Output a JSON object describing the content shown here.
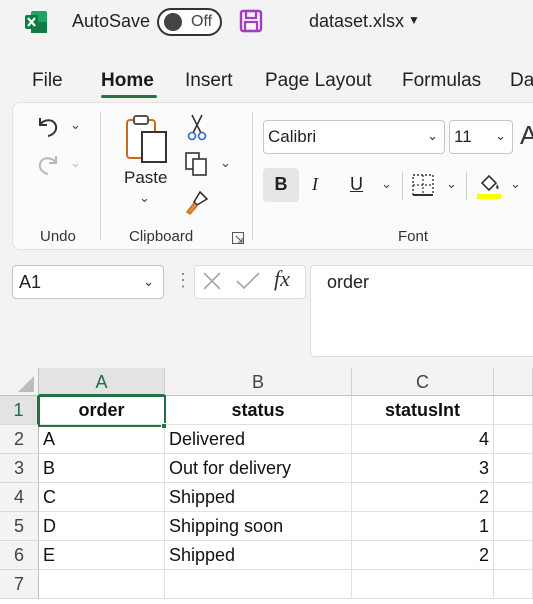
{
  "titlebar": {
    "autosave_label": "AutoSave",
    "autosave_state": "Off",
    "filename": "dataset.xlsx"
  },
  "tabs": [
    "File",
    "Home",
    "Insert",
    "Page Layout",
    "Formulas",
    "Da"
  ],
  "ribbon": {
    "groups": {
      "undo": "Undo",
      "clipboard": "Clipboard",
      "font": "Font"
    },
    "paste_label": "Paste",
    "font_name": "Calibri",
    "font_size": "11",
    "bold": "B",
    "italic": "I",
    "underline": "U",
    "grow_font": "A",
    "fill_color": "#ffff00"
  },
  "formula_bar": {
    "name_box": "A1",
    "fx_label": "fx",
    "formula": "order"
  },
  "sheet": {
    "columns": [
      "A",
      "B",
      "C"
    ],
    "rows": [
      "1",
      "2",
      "3",
      "4",
      "5",
      "6",
      "7"
    ],
    "header": [
      "order",
      "status",
      "statusInt"
    ],
    "data": [
      [
        "A",
        "Delivered",
        "4"
      ],
      [
        "B",
        "Out for delivery",
        "3"
      ],
      [
        "C",
        "Shipped",
        "2"
      ],
      [
        "D",
        "Shipping soon",
        "1"
      ],
      [
        "E",
        "Shipped",
        "2"
      ]
    ]
  },
  "colors": {
    "accent": "#217346",
    "excel_green": "#107c41",
    "save_purple": "#a33cc0"
  }
}
